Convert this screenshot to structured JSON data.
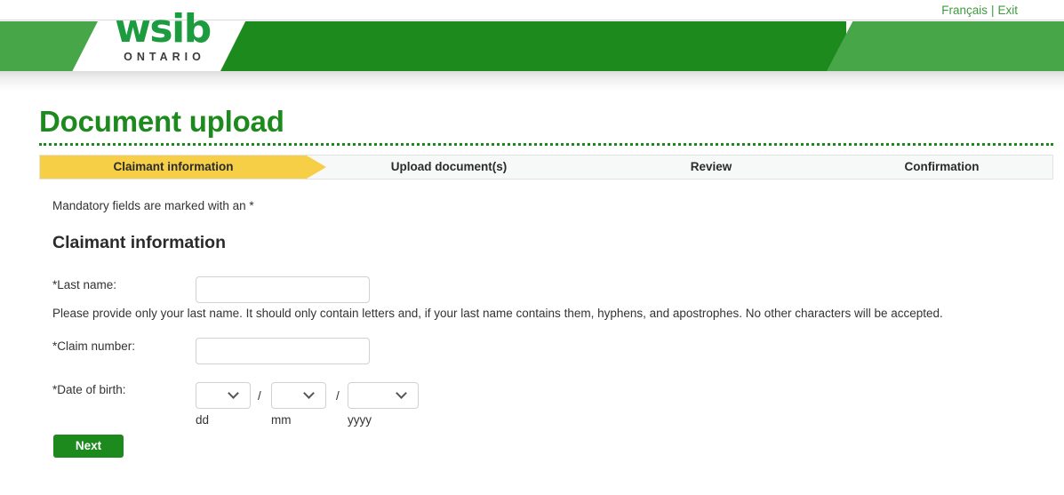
{
  "topbar": {
    "francais_label": "Français",
    "separator": "|",
    "exit_label": "Exit"
  },
  "brand": {
    "wordmark": "wsib",
    "subtitle": "ONTARIO",
    "green_primary": "#1d8a1d",
    "green_light": "#46a648",
    "green_logo": "#1d9b3f"
  },
  "header": {
    "page_title": "Document upload"
  },
  "steps": {
    "items": [
      {
        "label": "Claimant information",
        "active": true
      },
      {
        "label": "Upload document(s)",
        "active": false
      },
      {
        "label": "Review",
        "active": false
      },
      {
        "label": "Confirmation",
        "active": false
      }
    ],
    "active_color": "#f7cf47"
  },
  "form": {
    "mandatory_note": "Mandatory fields are marked with an *",
    "section_title": "Claimant information",
    "last_name": {
      "label": "*Last name:",
      "value": "",
      "placeholder": "",
      "help": "Please provide only your last name. It should only contain letters and, if your last name contains them, hyphens, and apostrophes. No other characters will be accepted."
    },
    "claim_number": {
      "label": "*Claim number:",
      "value": "",
      "placeholder": ""
    },
    "date_of_birth": {
      "label": "*Date of birth:",
      "separator": "/",
      "day": {
        "value": "",
        "hint": "dd"
      },
      "month": {
        "value": "",
        "hint": "mm"
      },
      "year": {
        "value": "",
        "hint": "yyyy"
      }
    },
    "next_button": "Next"
  }
}
